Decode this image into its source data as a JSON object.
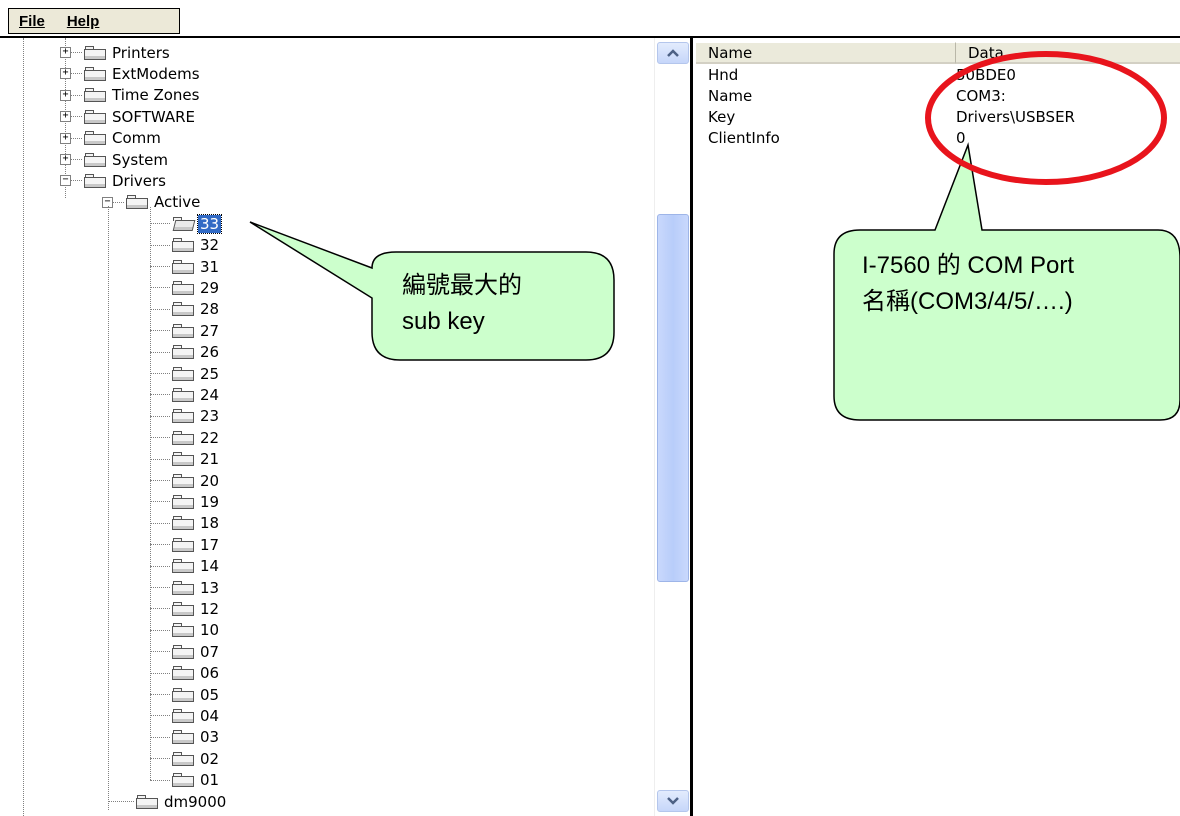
{
  "menu": {
    "items": [
      {
        "label": "File"
      },
      {
        "label": "Help"
      }
    ]
  },
  "tree": {
    "top_nodes": [
      {
        "label": "Printers",
        "expander": "+"
      },
      {
        "label": "ExtModems",
        "expander": "+"
      },
      {
        "label": "Time Zones",
        "expander": "+"
      },
      {
        "label": "SOFTWARE",
        "expander": "+"
      },
      {
        "label": "Comm",
        "expander": "+"
      },
      {
        "label": "System",
        "expander": "+"
      },
      {
        "label": "Drivers",
        "expander": "−"
      }
    ],
    "active_node": {
      "label": "Active",
      "expander": "−"
    },
    "subkeys": [
      "33",
      "32",
      "31",
      "29",
      "28",
      "27",
      "26",
      "25",
      "24",
      "23",
      "22",
      "21",
      "20",
      "19",
      "18",
      "17",
      "14",
      "13",
      "12",
      "10",
      "07",
      "06",
      "05",
      "04",
      "03",
      "02",
      "01"
    ],
    "selected_subkey": "33",
    "last_node": {
      "label": "dm9000"
    }
  },
  "listview": {
    "columns": [
      "Name",
      "Data"
    ],
    "rows": [
      {
        "name": "Hnd",
        "data": "50BDE0"
      },
      {
        "name": "Name",
        "data": "COM3:"
      },
      {
        "name": "Key",
        "data": "Drivers\\USBSER"
      },
      {
        "name": "ClientInfo",
        "data": "0"
      }
    ]
  },
  "annotations": {
    "left_callout": {
      "line1": "編號最大的",
      "line2": "sub key"
    },
    "right_callout": {
      "line1": "I-7560 的 COM Port",
      "line2": "名稱(COM3/4/5/….)"
    },
    "callout_fill": "#ccffcc",
    "highlight_ellipse_color": "#e8141c",
    "selection_color": "#316ac5"
  }
}
